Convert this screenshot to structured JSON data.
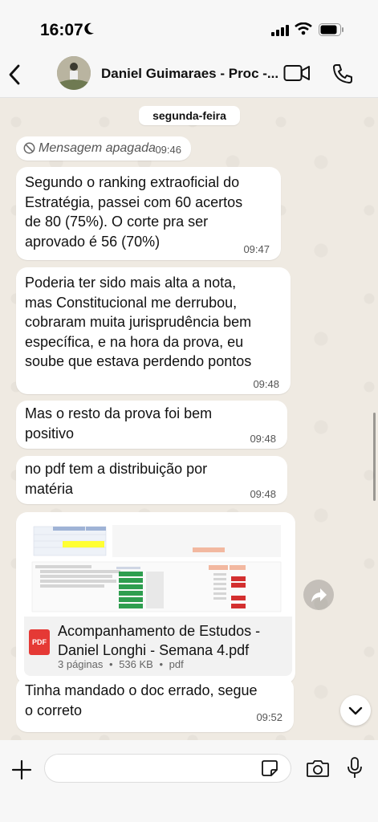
{
  "status_bar": {
    "time": "16:07"
  },
  "header": {
    "contact_name": "Daniel Guimaraes - Proc -..."
  },
  "chat": {
    "day_label": "segunda-feira",
    "deleted": {
      "text": "Mensagem apagada",
      "time": "09:46"
    },
    "messages": [
      {
        "text": "Segundo o ranking extraoficial do\nEstratégia, passei com 60 acertos\nde 80 (75%). O corte pra ser\naprovado é 56 (70%)",
        "time": "09:47"
      },
      {
        "text": "Poderia ter sido mais alta a nota,\nmas Constitucional me derrubou,\ncobraram muita jurisprudência bem\nespecífica, e na hora da prova, eu\nsoube que estava perdendo pontos",
        "time": "09:48"
      },
      {
        "text": "Mas o resto da prova foi bem\npositivo",
        "time": "09:48"
      },
      {
        "text": "no pdf tem a distribuição por\nmatéria",
        "time": "09:48"
      }
    ],
    "document": {
      "icon_label": "PDF",
      "title": "Acompanhamento de Estudos -\nDaniel Longhi  - Semana 4.pdf",
      "pages": "3 páginas",
      "sep": "•",
      "size": "536 KB",
      "type": "pdf"
    },
    "last_message": {
      "text": "Tinha mandado o doc errado, segue\no correto",
      "time": "09:52"
    }
  },
  "composer": {
    "placeholder": ""
  },
  "colors": {
    "chat_bg": "#efeae2",
    "bubble": "#ffffff",
    "pdf_red": "#e53935"
  }
}
